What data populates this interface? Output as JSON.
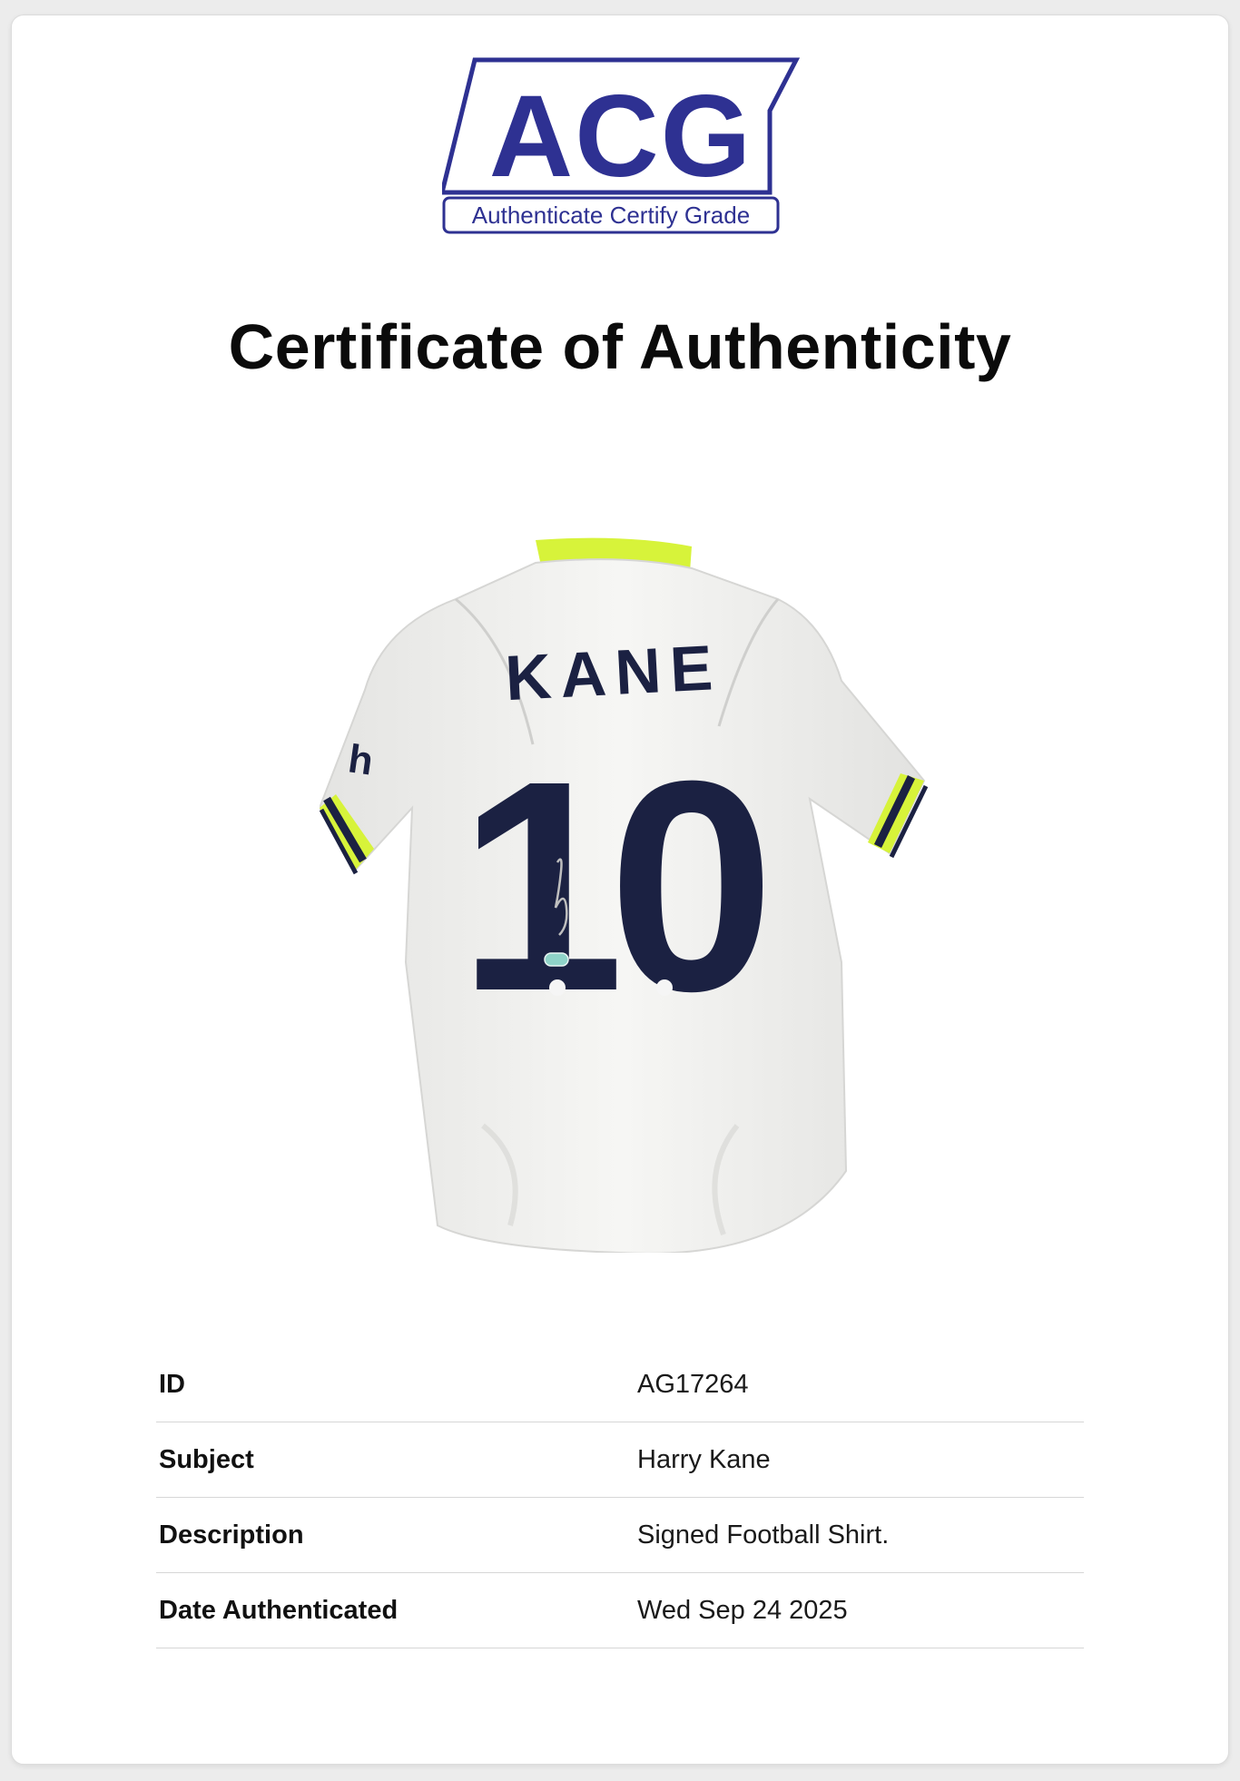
{
  "logo": {
    "mark": "ACG",
    "tagline": "Authenticate Certify Grade",
    "brand_color": "#2e3192"
  },
  "title": "Certificate of Authenticity",
  "item_image": {
    "icon": "football-shirt-image",
    "name": "KANE",
    "number": "10",
    "shirt_color": "#f2f2f0",
    "accent_color": "#d7f33a",
    "print_color": "#1b2142"
  },
  "details": {
    "rows": [
      {
        "label": "ID",
        "value": "AG17264"
      },
      {
        "label": "Subject",
        "value": "Harry Kane"
      },
      {
        "label": "Description",
        "value": "Signed Football Shirt."
      },
      {
        "label": "Date Authenticated",
        "value": "Wed Sep 24 2025"
      }
    ]
  }
}
